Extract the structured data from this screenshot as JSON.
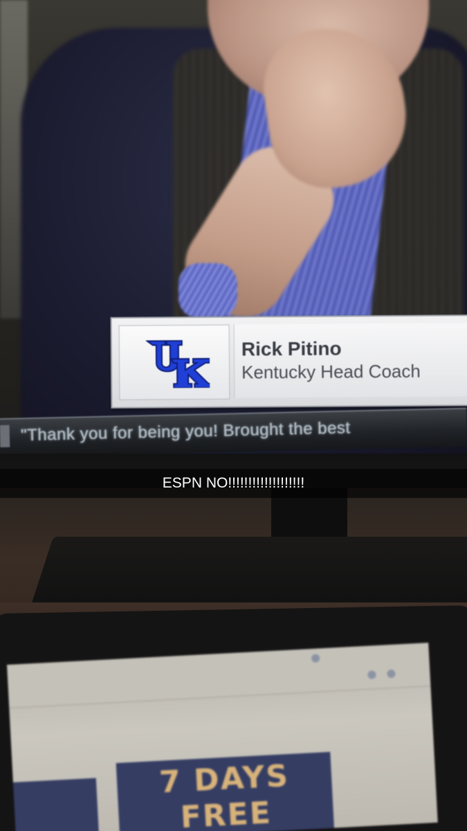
{
  "lower_third": {
    "logo_text": "UK",
    "name": "Rick Pitino",
    "title": "Kentucky Head Coach"
  },
  "ticker": {
    "text": "\"Thank you for being you! Brought the best"
  },
  "caption": {
    "text": "ESPN NO!!!!!!!!!!!!!!!!!!!"
  },
  "laptop_ad": {
    "line1": "7 DAYS",
    "line2": "FREE"
  },
  "colors": {
    "uk_blue": "#1f3fd6",
    "caption_bg": "#000000",
    "caption_text": "#ffffff",
    "ad_navy": "#353d63",
    "ad_gold": "#d7b27a"
  }
}
